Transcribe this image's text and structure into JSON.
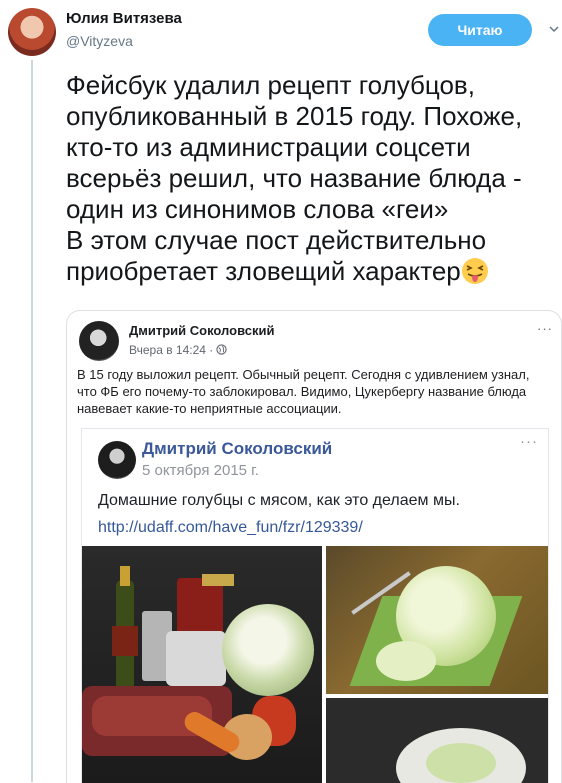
{
  "tweet": {
    "display_name": "Юлия Витязева",
    "handle": "@Vityzeva",
    "follow_label": "Читаю",
    "text": "Фейсбук удалил рецепт голубцов, опубликованный в 2015 году. Похоже, кто-то из администрации соцсети всерьёз решил, что название блюда - один из синонимов слова «геи»\nВ этом случае пост действительно приобретает зловещий характер",
    "emoji_icon": "squinting-tongue-face-icon"
  },
  "fb_post": {
    "author": "Дмитрий Соколовский",
    "date": "Вчера в 14:24 ·",
    "more": "···",
    "text": "В 15 году выложил рецепт. Обычный рецепт. Сегодня с удивлением узнал, что ФБ его почему-то заблокировал. Видимо, Цукербергу название блюда навевает какие-то неприятные ассоциации.",
    "inner": {
      "author": "Дмитрий Соколовский",
      "date": "5 октября 2015 г.",
      "more": "···",
      "text": "Домашние голубцы с мясом, как это делаем мы.",
      "link": "http://udaff.com/have_fun/fzr/129339/"
    }
  },
  "colors": {
    "follow_button": "#4ab3f4",
    "fb_link": "#365899",
    "fb_name": "#3b5998"
  }
}
